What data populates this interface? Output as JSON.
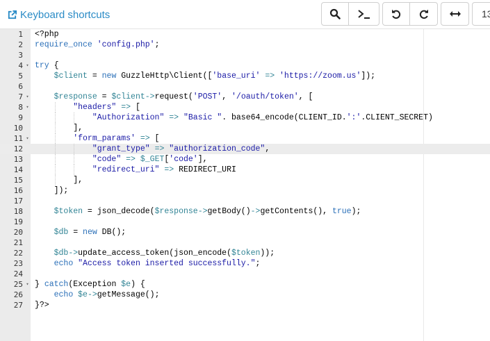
{
  "toolbar": {
    "shortcuts_label": "Keyboard shortcuts",
    "font_size": "13"
  },
  "editor": {
    "active_line": 12,
    "lines": [
      {
        "n": "1",
        "fold": false,
        "indent": 0,
        "code": "<?php"
      },
      {
        "n": "2",
        "fold": false,
        "indent": 0,
        "code": "require_once 'config.php';"
      },
      {
        "n": "3",
        "fold": false,
        "indent": 0,
        "code": ""
      },
      {
        "n": "4",
        "fold": true,
        "indent": 0,
        "code": "try {"
      },
      {
        "n": "5",
        "fold": false,
        "indent": 1,
        "code": "    $client = new GuzzleHttp\\Client(['base_uri' => 'https://zoom.us']);"
      },
      {
        "n": "6",
        "fold": false,
        "indent": 1,
        "code": ""
      },
      {
        "n": "7",
        "fold": true,
        "indent": 1,
        "code": "    $response = $client->request('POST', '/oauth/token', ["
      },
      {
        "n": "8",
        "fold": true,
        "indent": 2,
        "code": "        \"headers\" => ["
      },
      {
        "n": "9",
        "fold": false,
        "indent": 3,
        "code": "            \"Authorization\" => \"Basic \". base64_encode(CLIENT_ID.':'.CLIENT_SECRET)"
      },
      {
        "n": "10",
        "fold": false,
        "indent": 2,
        "code": "        ],"
      },
      {
        "n": "11",
        "fold": true,
        "indent": 2,
        "code": "        'form_params' => ["
      },
      {
        "n": "12",
        "fold": false,
        "indent": 3,
        "code": "            \"grant_type\" => \"authorization_code\","
      },
      {
        "n": "13",
        "fold": false,
        "indent": 3,
        "code": "            \"code\" => $_GET['code'],"
      },
      {
        "n": "14",
        "fold": false,
        "indent": 3,
        "code": "            \"redirect_uri\" => REDIRECT_URI"
      },
      {
        "n": "15",
        "fold": false,
        "indent": 2,
        "code": "        ],"
      },
      {
        "n": "16",
        "fold": false,
        "indent": 1,
        "code": "    ]);"
      },
      {
        "n": "17",
        "fold": false,
        "indent": 1,
        "code": ""
      },
      {
        "n": "18",
        "fold": false,
        "indent": 1,
        "code": "    $token = json_decode($response->getBody()->getContents(), true);"
      },
      {
        "n": "19",
        "fold": false,
        "indent": 1,
        "code": ""
      },
      {
        "n": "20",
        "fold": false,
        "indent": 1,
        "code": "    $db = new DB();"
      },
      {
        "n": "21",
        "fold": false,
        "indent": 1,
        "code": ""
      },
      {
        "n": "22",
        "fold": false,
        "indent": 1,
        "code": "    $db->update_access_token(json_encode($token));"
      },
      {
        "n": "23",
        "fold": false,
        "indent": 1,
        "code": "    echo \"Access token inserted successfully.\";"
      },
      {
        "n": "24",
        "fold": false,
        "indent": 1,
        "code": ""
      },
      {
        "n": "25",
        "fold": true,
        "indent": 0,
        "code": "} catch(Exception $e) {"
      },
      {
        "n": "26",
        "fold": false,
        "indent": 1,
        "code": "    echo $e->getMessage();"
      },
      {
        "n": "27",
        "fold": false,
        "indent": 0,
        "code": "}?>"
      }
    ]
  },
  "colors": {
    "keyword": "#2a6fb8",
    "string": "#1a1aa6",
    "variable": "#318495",
    "link": "#2a8bc6",
    "gutter": "#ebebeb",
    "active_line": "#ececec"
  }
}
